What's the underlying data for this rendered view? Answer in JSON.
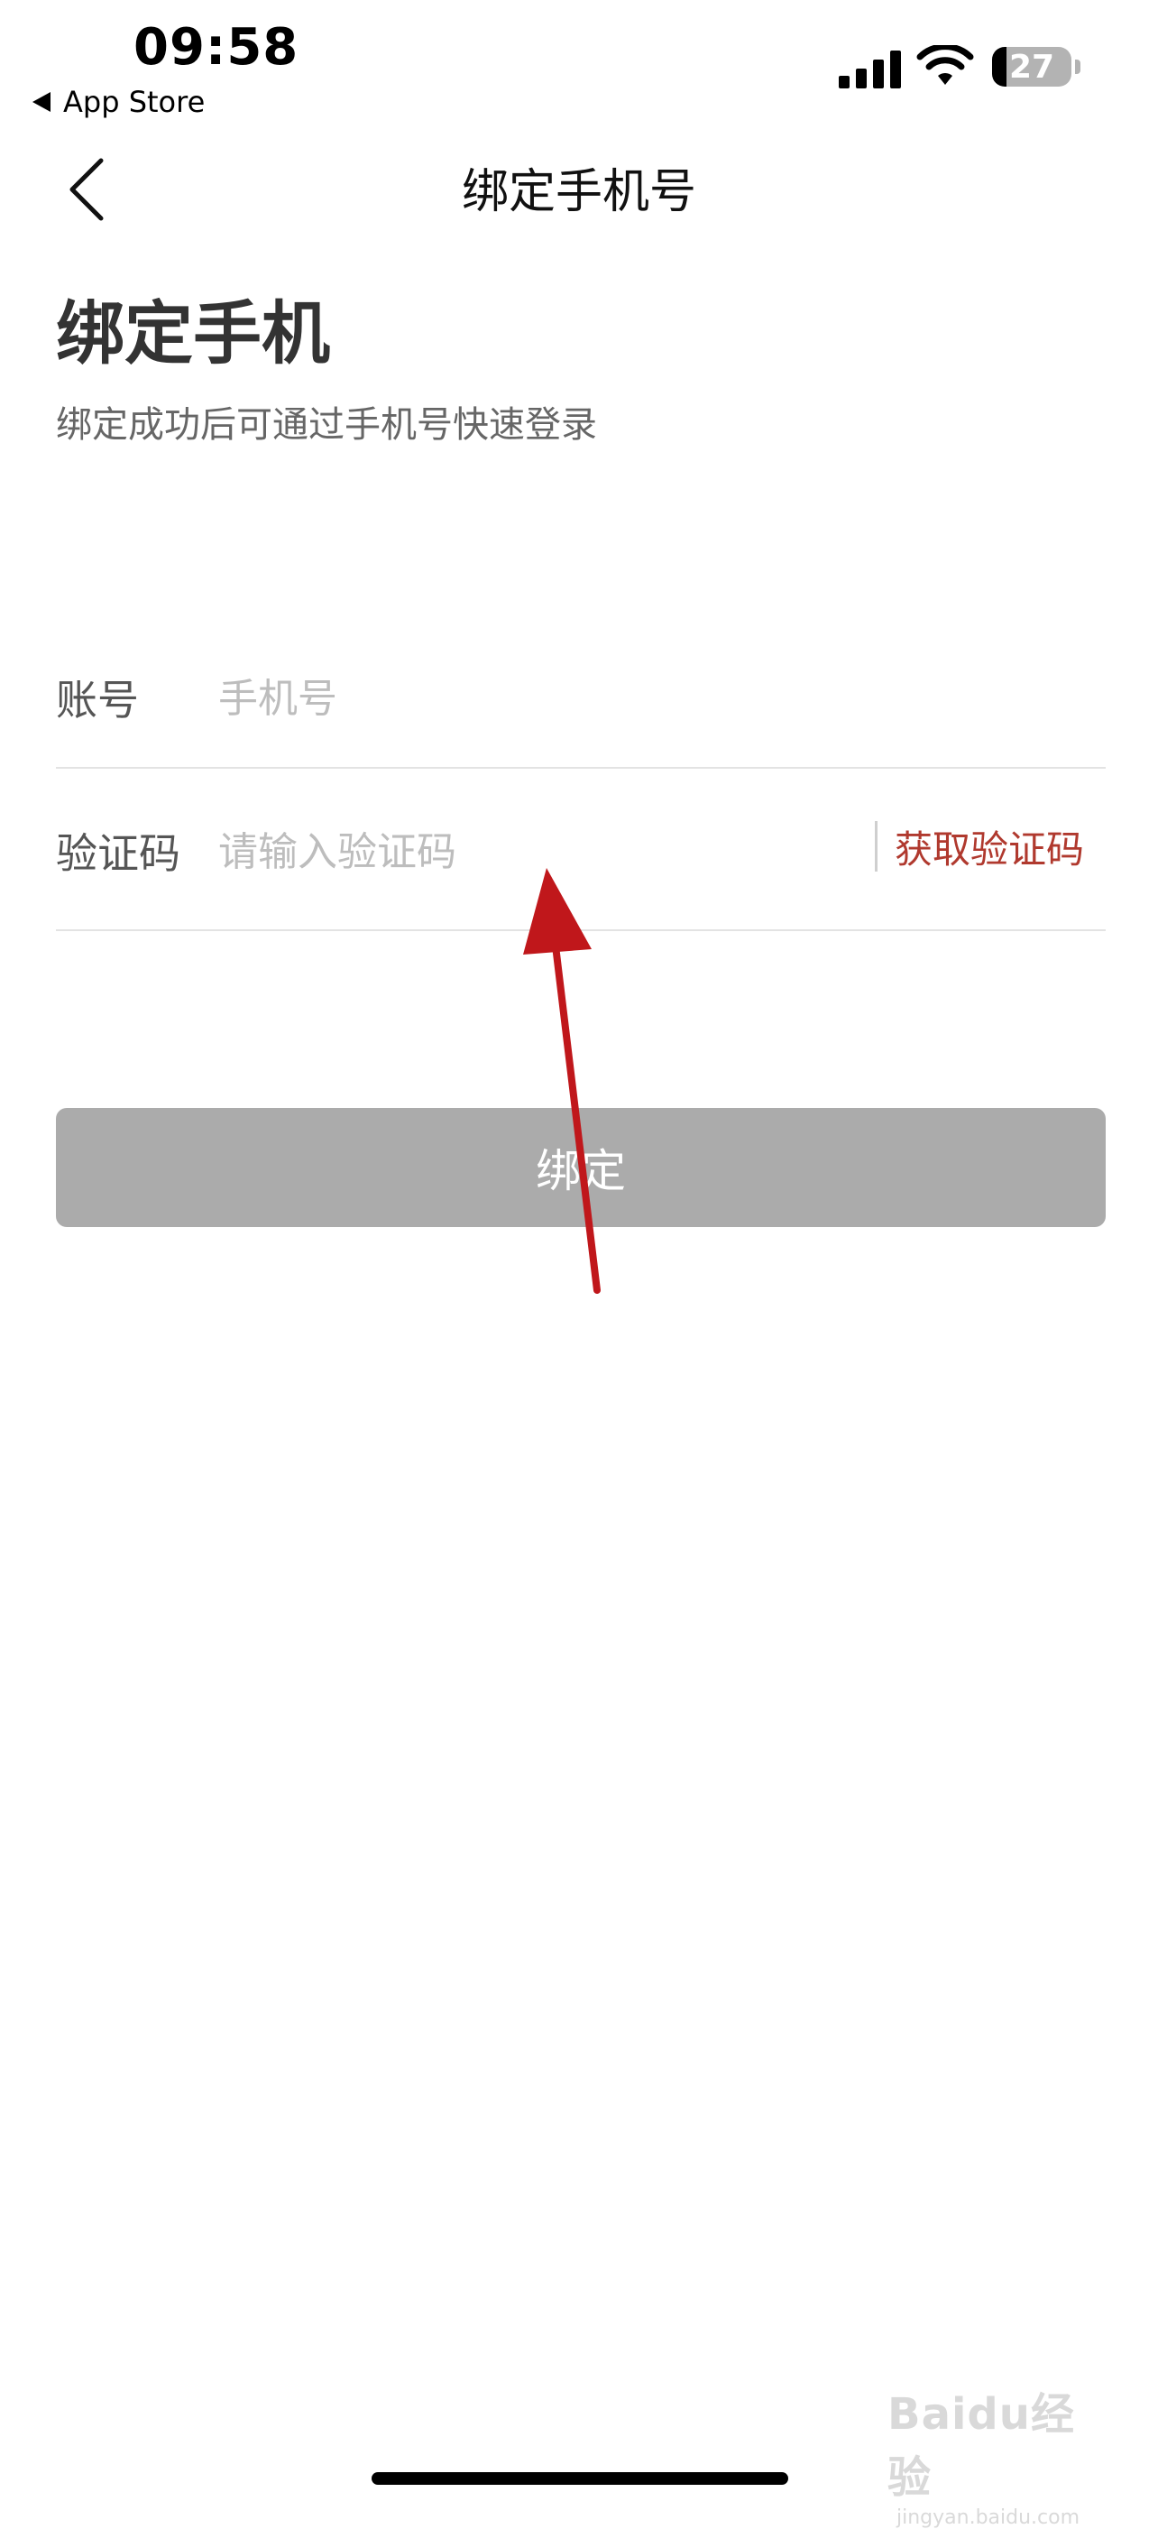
{
  "status_bar": {
    "time": "09:58",
    "back_app_label": "App Store",
    "battery_level": "27",
    "icons": [
      "signal-icon",
      "wifi-icon",
      "battery-icon"
    ]
  },
  "nav": {
    "title": "绑定手机号",
    "back_icon": "chevron-left-icon"
  },
  "header": {
    "title": "绑定手机",
    "subtitle": "绑定成功后可通过手机号快速登录"
  },
  "form": {
    "account": {
      "label": "账号",
      "placeholder": "手机号",
      "value": ""
    },
    "code": {
      "label": "验证码",
      "placeholder": "请输入验证码",
      "value": "",
      "get_code_label": "获取验证码"
    }
  },
  "actions": {
    "bind_label": "绑定"
  },
  "colors": {
    "accent": "#b0392e",
    "button_disabled": "#ababab",
    "annotation_arrow": "#c0171b"
  },
  "watermark": {
    "main": "Baidu经验",
    "sub": "jingyan.baidu.com"
  }
}
